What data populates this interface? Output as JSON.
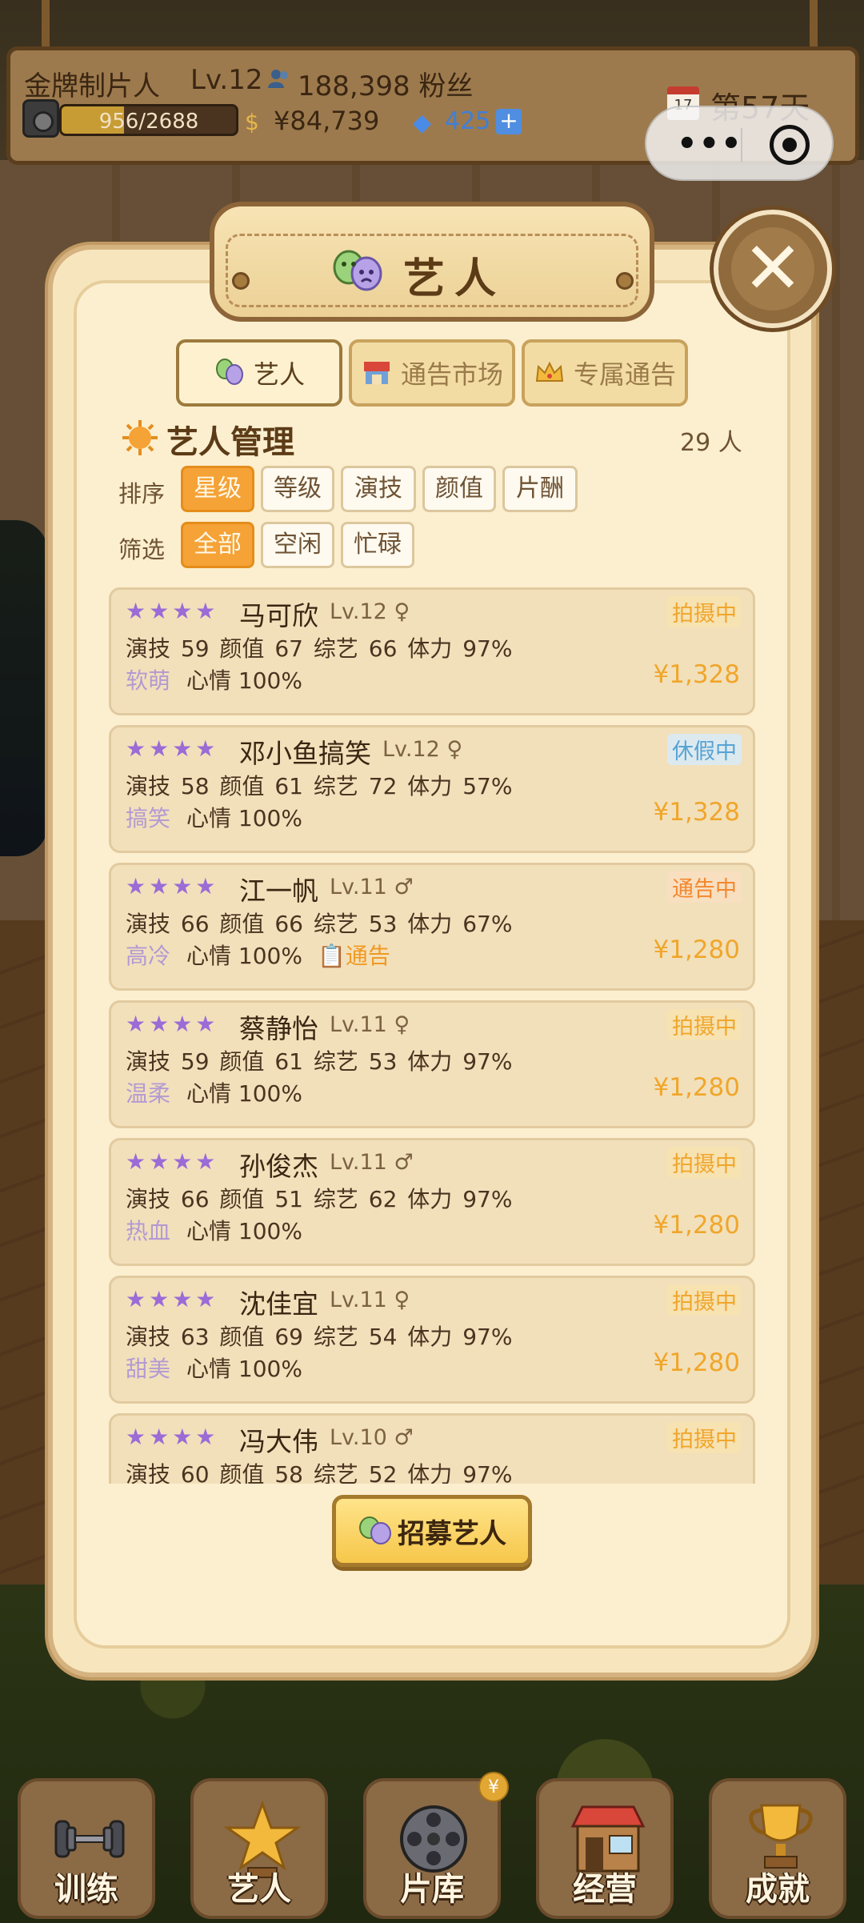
{
  "status_bar": {
    "title": "金牌制片人",
    "level": "Lv.12",
    "fans": "188,398 粉丝",
    "xp": "956/2688",
    "xp_progress": 0.356,
    "money": "¥84,739",
    "gems": "425",
    "day": "第57天"
  },
  "modal": {
    "title": "艺人",
    "tabs": [
      {
        "label": "艺人",
        "icon": "theater-masks-icon",
        "active": true
      },
      {
        "label": "通告市场",
        "icon": "market-stall-icon",
        "active": false
      },
      {
        "label": "专属通告",
        "icon": "crown-icon",
        "active": false
      }
    ],
    "section_title": "艺人管理",
    "count": "29 人",
    "sort_label": "排序",
    "sort_options": [
      "星级",
      "等级",
      "演技",
      "颜值",
      "片酬"
    ],
    "filter_label": "筛选",
    "filter_options": [
      "全部",
      "空闲",
      "忙碌"
    ],
    "artists": [
      {
        "stars": "★★★★",
        "name": "马可欣",
        "level": "Lv.12 ♀",
        "stats": "演技 59  颜值 67  综艺 66  体力 97%",
        "trait": "软萌",
        "mood": "心情 100%",
        "notice": "",
        "status": "拍摄中",
        "status_type": "shoot",
        "pay": "¥1,328"
      },
      {
        "stars": "★★★★",
        "name": "邓小鱼搞笑",
        "level": "Lv.12 ♀",
        "stats": "演技 58  颜值 61  综艺 72  体力 57%",
        "trait": "搞笑",
        "mood": "心情 100%",
        "notice": "",
        "status": "休假中",
        "status_type": "vac",
        "pay": "¥1,328"
      },
      {
        "stars": "★★★★",
        "name": "江一帆",
        "level": "Lv.11 ♂",
        "stats": "演技 66  颜值 66  综艺 53  体力 67%",
        "trait": "高冷",
        "mood": "心情 100%",
        "notice": "📋通告",
        "status": "通告中",
        "status_type": "notice",
        "pay": "¥1,280"
      },
      {
        "stars": "★★★★",
        "name": "蔡静怡",
        "level": "Lv.11 ♀",
        "stats": "演技 59  颜值 61  综艺 53  体力 97%",
        "trait": "温柔",
        "mood": "心情 100%",
        "notice": "",
        "status": "拍摄中",
        "status_type": "shoot",
        "pay": "¥1,280"
      },
      {
        "stars": "★★★★",
        "name": "孙俊杰",
        "level": "Lv.11 ♂",
        "stats": "演技 66  颜值 51  综艺 62  体力 97%",
        "trait": "热血",
        "mood": "心情 100%",
        "notice": "",
        "status": "拍摄中",
        "status_type": "shoot",
        "pay": "¥1,280"
      },
      {
        "stars": "★★★★",
        "name": "沈佳宜",
        "level": "Lv.11 ♀",
        "stats": "演技 63  颜值 69  综艺 54  体力 97%",
        "trait": "甜美",
        "mood": "心情 100%",
        "notice": "",
        "status": "拍摄中",
        "status_type": "shoot",
        "pay": "¥1,280"
      },
      {
        "stars": "★★★★",
        "name": "冯大伟",
        "level": "Lv.10 ♂",
        "stats": "演技 60  颜值 58  综艺 52  体力 97%",
        "trait": "",
        "mood": "",
        "notice": "",
        "status": "拍摄中",
        "status_type": "shoot",
        "pay": ""
      }
    ],
    "recruit_label": "招募艺人"
  },
  "bottom_nav": [
    {
      "label": "训练",
      "icon": "dumbbell-icon"
    },
    {
      "label": "艺人",
      "icon": "star-trophy-icon"
    },
    {
      "label": "片库",
      "icon": "film-reel-icon",
      "badge": "¥"
    },
    {
      "label": "经营",
      "icon": "shop-icon"
    },
    {
      "label": "成就",
      "icon": "trophy-icon"
    }
  ],
  "colors": {
    "accent_orange": "#f5a236",
    "star_purple": "#9b6bd6",
    "panel_cream": "#fcefcf",
    "gem_blue": "#3f7fd8"
  }
}
